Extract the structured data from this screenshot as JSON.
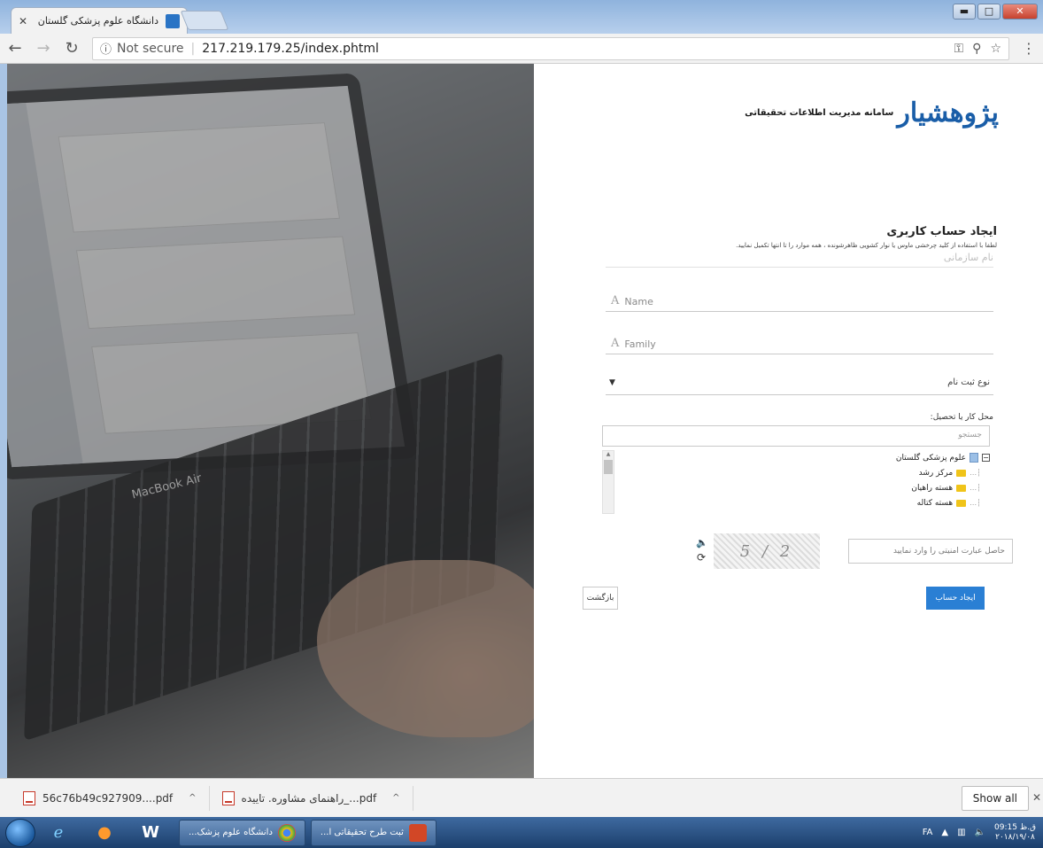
{
  "browser": {
    "tab_title": "دانشگاه علوم پزشکی گلستان",
    "tab_close": "✕",
    "url_info_icon": "ⓘ",
    "security_label": "Not secure",
    "url": "217.219.179.25/index.phtml",
    "window_controls": {
      "minimize": "▬",
      "maximize": "□",
      "close": "✕"
    }
  },
  "page": {
    "logo_mark": "پژوهشیار",
    "logo_text": "سامانه مدیریت اطلاعات تحقیقاتی",
    "heading": "ایجاد حساب کاربری",
    "hint": "لطفا با استفاده از کلید چرخشی ماوس یا نوار کشویی ظاهرشونده ، همه موارد را تا انتها تکمیل نمایید.",
    "cut_field_placeholder": "نام سازمانی",
    "name_placeholder": "Name",
    "family_placeholder": "Family",
    "field_icon": "A",
    "registration_type": "نوع ثبت نام",
    "select_arrow": "▼",
    "workplace_label": "محل کار یا تحصیل:",
    "tree_search_placeholder": "جستجو",
    "tree": {
      "root": "علوم پزشکی گلستان",
      "children": [
        "مرکز رشد",
        "هسته راهیان",
        "هسته کتاله"
      ]
    },
    "captcha_placeholder": "حاصل عبارت امنیتی را وارد نمایید",
    "captcha_text": "5 / 2",
    "create_button": "ایجاد حساب",
    "back_button": "بازگشت",
    "laptop_brand": "MacBook Air"
  },
  "downloads": {
    "items": [
      {
        "name": "56c76b49c927909....pdf"
      },
      {
        "name": "راهنمای مشاوره. تاییده_...pdf"
      }
    ],
    "show_all": "Show all",
    "close": "✕"
  },
  "taskbar": {
    "tasks": [
      {
        "label": "دانشگاه علوم پزشک...",
        "color": "#e44d26"
      },
      {
        "label": "ثبت طرح تحقیقاتی ا...",
        "color": "#d24726"
      }
    ],
    "tray_lang": "FA",
    "clock_time": "09:15 ق.ظ",
    "clock_date": "۲۰۱۸/۱۹/۰۸"
  },
  "colors": {
    "accent": "#2a7fd4",
    "logo_blue": "#1a5ea8"
  }
}
